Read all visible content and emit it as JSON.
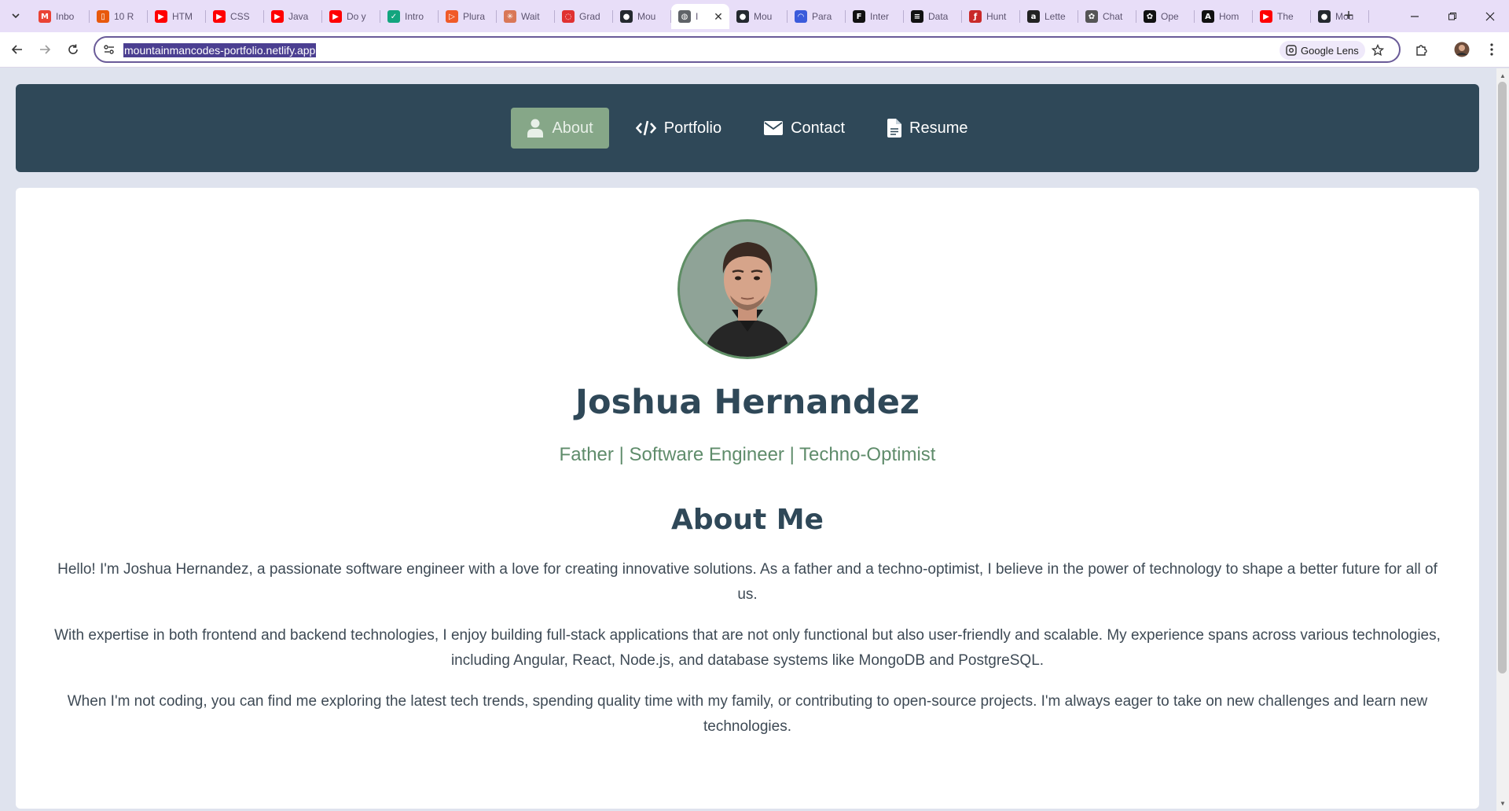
{
  "browser": {
    "tabs": [
      {
        "label": "Inbo",
        "icon": "gmail-icon",
        "color": "#ea4335",
        "glyph": "M"
      },
      {
        "label": "10 R",
        "icon": "bookmark-icon",
        "color": "#e8590c",
        "glyph": "▯"
      },
      {
        "label": "HTM",
        "icon": "youtube-icon",
        "color": "#ff0000",
        "glyph": "▶"
      },
      {
        "label": "CSS",
        "icon": "youtube-icon",
        "color": "#ff0000",
        "glyph": "▶"
      },
      {
        "label": "Java",
        "icon": "youtube-icon",
        "color": "#ff0000",
        "glyph": "▶"
      },
      {
        "label": "Do y",
        "icon": "youtube-icon",
        "color": "#ff0000",
        "glyph": "▶"
      },
      {
        "label": "Intro",
        "icon": "shield-check-icon",
        "color": "#13a57e",
        "glyph": "✓"
      },
      {
        "label": "Plura",
        "icon": "pluralsight-icon",
        "color": "#f05a28",
        "glyph": "▷"
      },
      {
        "label": "Wait",
        "icon": "sparkle-icon",
        "color": "#d97757",
        "glyph": "✳"
      },
      {
        "label": "Grad",
        "icon": "ring-icon",
        "color": "#e03131",
        "glyph": "◌"
      },
      {
        "label": "Mou",
        "icon": "github-icon",
        "color": "#24292f",
        "glyph": "●"
      },
      {
        "label": "I",
        "icon": "globe-icon",
        "color": "#5f6368",
        "glyph": "◍"
      },
      {
        "label": "Mou",
        "icon": "github-icon",
        "color": "#24292f",
        "glyph": "●"
      },
      {
        "label": "Para",
        "icon": "arc-icon",
        "color": "#3b5bdb",
        "glyph": "◠"
      },
      {
        "label": "Inter",
        "icon": "if-icon",
        "color": "#111111",
        "glyph": "F"
      },
      {
        "label": "Data",
        "icon": "data-icon",
        "color": "#111111",
        "glyph": "≡"
      },
      {
        "label": "Hunt",
        "icon": "fx-icon",
        "color": "#c92a2a",
        "glyph": "ƒ"
      },
      {
        "label": "Lette",
        "icon": "amazon-icon",
        "color": "#222222",
        "glyph": "a"
      },
      {
        "label": "Chat",
        "icon": "openai-icon",
        "color": "#555555",
        "glyph": "✿"
      },
      {
        "label": "Ope",
        "icon": "openai-icon",
        "color": "#111111",
        "glyph": "✿"
      },
      {
        "label": "Hom",
        "icon": "anthropic-icon",
        "color": "#111111",
        "glyph": "A"
      },
      {
        "label": "The",
        "icon": "youtube-icon",
        "color": "#ff0000",
        "glyph": "▶"
      },
      {
        "label": "Mou",
        "icon": "github-icon",
        "color": "#24292f",
        "glyph": "●"
      }
    ],
    "active_tab_index": 11,
    "url": "mountainmancodes-portfolio.netlify.app",
    "lens_label": "Google Lens"
  },
  "site": {
    "nav": [
      {
        "label": "About",
        "icon": "user-icon",
        "active": true
      },
      {
        "label": "Portfolio",
        "icon": "code-icon",
        "active": false
      },
      {
        "label": "Contact",
        "icon": "envelope-icon",
        "active": false
      },
      {
        "label": "Resume",
        "icon": "file-icon",
        "active": false
      }
    ],
    "name": "Joshua Hernandez",
    "tagline": "Father | Software Engineer | Techno-Optimist",
    "about_title": "About Me",
    "paragraphs": [
      "Hello! I'm Joshua Hernandez, a passionate software engineer with a love for creating innovative solutions. As a father and a techno-optimist, I believe in the power of technology to shape a better future for all of us.",
      "With expertise in both frontend and backend technologies, I enjoy building full-stack applications that are not only functional but also user-friendly and scalable. My experience spans across various technologies, including Angular, React, Node.js, and database systems like MongoDB and PostgreSQL.",
      "When I'm not coding, you can find me exploring the latest tech trends, spending quality time with my family, or contributing to open-source projects. I'm always eager to take on new challenges and learn new technologies."
    ]
  },
  "colors": {
    "nav_bg": "#2f4858",
    "nav_active": "#86a788",
    "heading": "#2f4858",
    "tagline": "#5f8c6b",
    "body_text": "#3e4a55",
    "page_bg": "#dfe3ee"
  }
}
